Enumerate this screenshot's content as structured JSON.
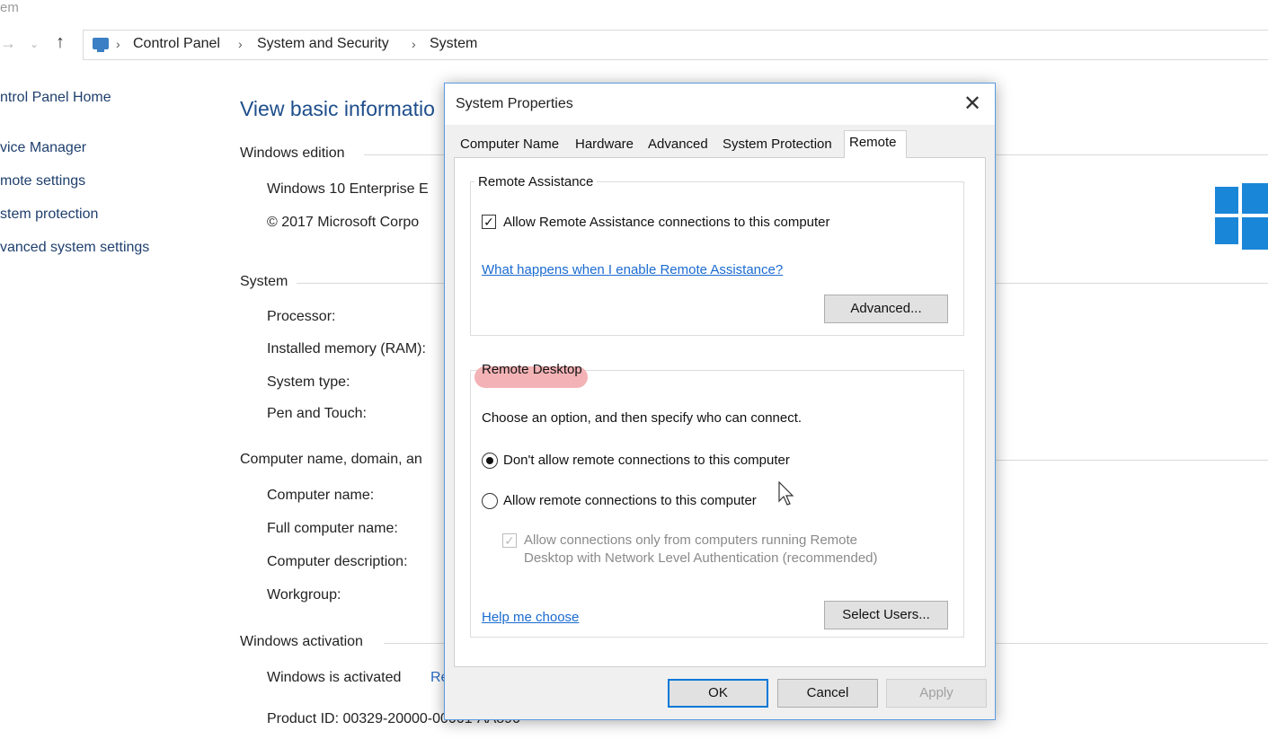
{
  "window": {
    "title_fragment": "em"
  },
  "nav": {
    "breadcrumbs": [
      "Control Panel",
      "System and Security",
      "System"
    ]
  },
  "sidebar": {
    "items": [
      {
        "label": "ntrol Panel Home"
      },
      {
        "label": "vice Manager"
      },
      {
        "label": "mote settings"
      },
      {
        "label": "stem protection"
      },
      {
        "label": "vanced system settings"
      }
    ]
  },
  "main": {
    "heading": "View basic informatio",
    "edition": {
      "title": "Windows edition",
      "name": "Windows 10 Enterprise E",
      "copyright": "© 2017 Microsoft Corpo"
    },
    "system": {
      "title": "System",
      "rows": [
        "Processor:",
        "Installed memory (RAM):",
        "System type:",
        "Pen and Touch:"
      ]
    },
    "computer": {
      "title": "Computer name, domain, an",
      "rows": [
        "Computer name:",
        "Full computer name:",
        "Computer description:",
        "Workgroup:"
      ]
    },
    "activation": {
      "title": "Windows activation",
      "status": "Windows is activated",
      "link_fragment": "Re",
      "product_id": "Product ID:  00329-20000-00001-AA890"
    }
  },
  "dialog": {
    "title": "System Properties",
    "close_glyph": "✕",
    "tabs": [
      {
        "label": "Computer Name"
      },
      {
        "label": "Hardware"
      },
      {
        "label": "Advanced"
      },
      {
        "label": "System Protection"
      },
      {
        "label": "Remote",
        "active": true
      }
    ],
    "remote_assistance": {
      "group_title": "Remote Assistance",
      "allow_label": "Allow Remote Assistance connections to this computer",
      "allow_checked": true,
      "help_link": "What happens when I enable Remote Assistance?",
      "advanced_button": "Advanced..."
    },
    "remote_desktop": {
      "group_title": "Remote Desktop",
      "instruction": "Choose an option, and then specify who can connect.",
      "options": [
        {
          "label": "Don't allow remote connections to this computer",
          "selected": true
        },
        {
          "label": "Allow remote connections to this computer",
          "selected": false
        }
      ],
      "nla_label": "Allow connections only from computers running Remote Desktop with Network Level Authentication (recommended)",
      "nla_checked": true,
      "help_link": "Help me choose",
      "select_users_button": "Select Users..."
    },
    "buttons": {
      "ok": "OK",
      "cancel": "Cancel",
      "apply": "Apply"
    },
    "check_glyph": "✓"
  },
  "colors": {
    "accent": "#0078d7",
    "link": "#1a6bd1",
    "highlight": "#f3b3b6",
    "windows_logo": "#1a86d8"
  }
}
